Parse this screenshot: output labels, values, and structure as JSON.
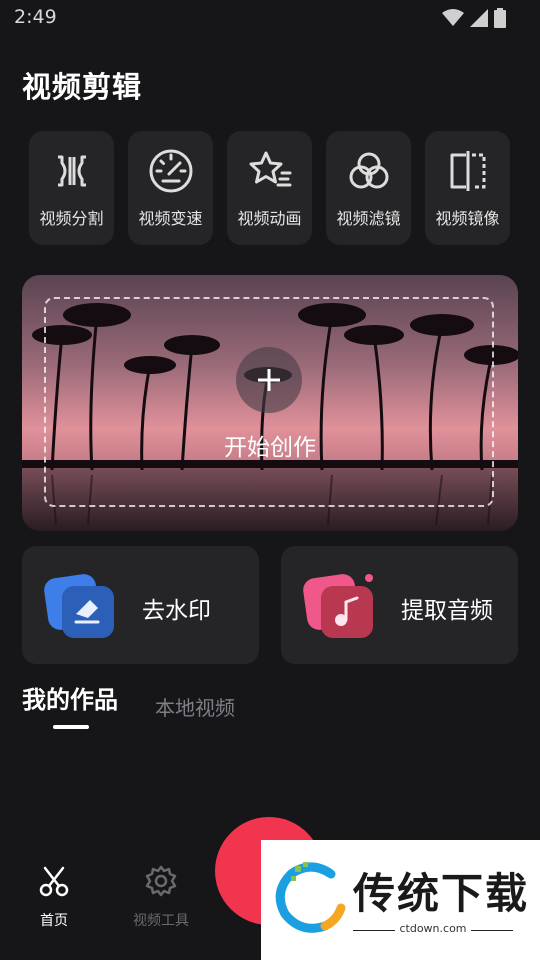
{
  "status_bar": {
    "time": "2:49"
  },
  "header": {
    "title": "视频剪辑"
  },
  "tools": [
    {
      "label": "视频分割",
      "icon": "split-icon"
    },
    {
      "label": "视频变速",
      "icon": "speedometer-icon"
    },
    {
      "label": "视频动画",
      "icon": "star-animation-icon"
    },
    {
      "label": "视频滤镜",
      "icon": "filter-circles-icon"
    },
    {
      "label": "视频镜像",
      "icon": "mirror-icon"
    }
  ],
  "banner": {
    "label": "开始创作",
    "icon": "plus-icon"
  },
  "cards": [
    {
      "label": "去水印",
      "icon": "eraser-icon"
    },
    {
      "label": "提取音频",
      "icon": "music-note-icon"
    }
  ],
  "tabs": {
    "active": "我的作品",
    "inactive": "本地视频"
  },
  "bottom_nav": {
    "home_label": "首页",
    "tools_label": "视频工具"
  },
  "watermark": {
    "text": "传统下载",
    "url": "ctdown.com"
  },
  "colors": {
    "background": "#161618",
    "card": "#252528",
    "accent": "#f2354f",
    "inactive_tab": "#7d7f87"
  }
}
